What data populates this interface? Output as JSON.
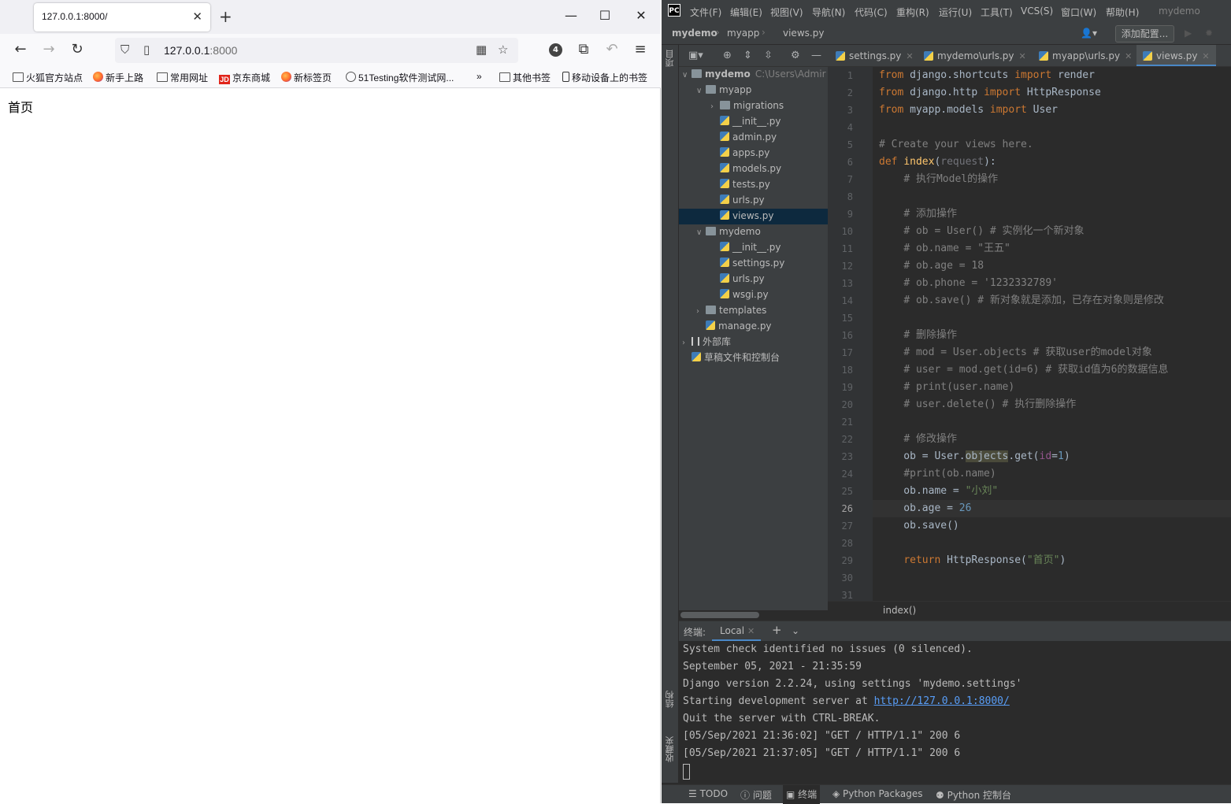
{
  "browser": {
    "tab_title": "127.0.0.1:8000/",
    "url_host": "127.0.0.1",
    "url_port": ":8000",
    "extension_badge": "4",
    "bookmarks": [
      "火狐官方站点",
      "新手上路",
      "常用网址",
      "京东商城",
      "新标签页",
      "51Testing软件测试网...",
      "其他书签",
      "移动设备上的书签"
    ],
    "jd_label": "JD",
    "page_text": "首页"
  },
  "ide": {
    "logo": "PC",
    "menu": [
      "文件(F)",
      "编辑(E)",
      "视图(V)",
      "导航(N)",
      "代码(C)",
      "重构(R)",
      "运行(U)",
      "工具(T)",
      "VCS(S)",
      "窗口(W)",
      "帮助(H)"
    ],
    "project_name": "mydemo",
    "breadcrumb": [
      "mydemo",
      "myapp",
      "views.py"
    ],
    "add_config": "添加配置...",
    "side_tabs": {
      "project": "项目",
      "structure": "结构",
      "favorites": "收藏夹"
    },
    "editor_tabs": [
      "settings.py",
      "mydemo\\urls.py",
      "myapp\\urls.py",
      "views.py"
    ],
    "tree": [
      {
        "label": "mydemo",
        "sub": "C:\\Users\\Admir",
        "type": "dir",
        "depth": 0,
        "open": true,
        "bold": true
      },
      {
        "label": "myapp",
        "type": "dir",
        "depth": 1,
        "open": true
      },
      {
        "label": "migrations",
        "type": "dir",
        "depth": 2,
        "open": false
      },
      {
        "label": "__init__.py",
        "type": "py",
        "depth": 2
      },
      {
        "label": "admin.py",
        "type": "py",
        "depth": 2
      },
      {
        "label": "apps.py",
        "type": "py",
        "depth": 2
      },
      {
        "label": "models.py",
        "type": "py",
        "depth": 2
      },
      {
        "label": "tests.py",
        "type": "py",
        "depth": 2
      },
      {
        "label": "urls.py",
        "type": "py",
        "depth": 2
      },
      {
        "label": "views.py",
        "type": "py",
        "depth": 2,
        "selected": true
      },
      {
        "label": "mydemo",
        "type": "dir",
        "depth": 1,
        "open": true
      },
      {
        "label": "__init__.py",
        "type": "py",
        "depth": 2
      },
      {
        "label": "settings.py",
        "type": "py",
        "depth": 2
      },
      {
        "label": "urls.py",
        "type": "py",
        "depth": 2
      },
      {
        "label": "wsgi.py",
        "type": "py",
        "depth": 2
      },
      {
        "label": "templates",
        "type": "dir",
        "depth": 1,
        "open": false
      },
      {
        "label": "manage.py",
        "type": "py",
        "depth": 1
      },
      {
        "label": "外部库",
        "type": "lib",
        "depth": 0,
        "open": false
      },
      {
        "label": "草稿文件和控制台",
        "type": "scratch",
        "depth": 0
      }
    ],
    "current_line": 26,
    "code_lines": [
      "from django.shortcuts import render",
      "from django.http import HttpResponse",
      "from myapp.models import User",
      "",
      "# Create your views here.",
      "def index(request):",
      "    # 执行Model的操作",
      "",
      "    # 添加操作",
      "    # ob = User() # 实例化一个新对象",
      "    # ob.name = \"王五\"",
      "    # ob.age = 18",
      "    # ob.phone = '1232332789'",
      "    # ob.save() # 新对象就是添加，已存在对象则是修改",
      "",
      "    # 删除操作",
      "    # mod = User.objects # 获取user的model对象",
      "    # user = mod.get(id=6) # 获取id值为6的数据信息",
      "    # print(user.name)",
      "    # user.delete() # 执行删除操作",
      "",
      "    # 修改操作",
      "    ob = User.objects.get(id=1)",
      "    #print(ob.name)",
      "    ob.name = \"小刘\"",
      "    ob.age = 26",
      "    ob.save()",
      "",
      "    return HttpResponse(\"首页\")",
      "",
      ""
    ],
    "code_breadcrumb": "index()",
    "terminal": {
      "label": "终端:",
      "tab": "Local",
      "lines": [
        "System check identified no issues (0 silenced).",
        "September 05, 2021 - 21:35:59",
        "Django version 2.2.24, using settings 'mydemo.settings'",
        "Starting development server at ",
        "Quit the server with CTRL-BREAK.",
        "[05/Sep/2021 21:36:02] \"GET / HTTP/1.1\" 200 6",
        "[05/Sep/2021 21:37:05] \"GET / HTTP/1.1\" 200 6"
      ],
      "server_url": "http://127.0.0.1:8000/"
    },
    "bottom_tabs": [
      "TODO",
      "问题",
      "终端",
      "Python Packages",
      "Python 控制台"
    ]
  }
}
